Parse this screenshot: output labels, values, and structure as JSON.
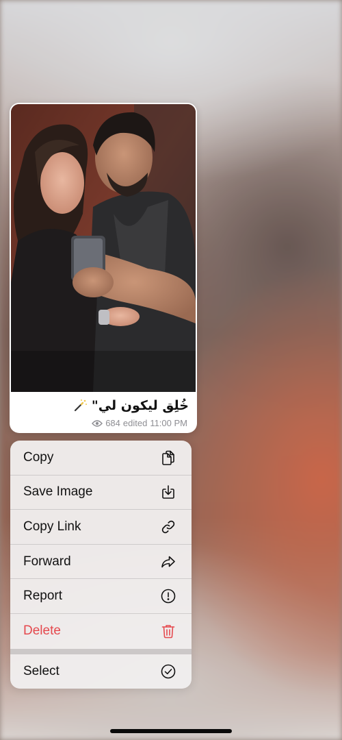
{
  "message": {
    "caption": "خُلِق ليكون لي\"",
    "views": "684",
    "edited_label": "edited",
    "time": "11:00 PM",
    "caption_icon": "magic-wand-icon"
  },
  "menu": {
    "items": [
      {
        "label": "Copy",
        "icon": "copy-icon"
      },
      {
        "label": "Save Image",
        "icon": "save-image-icon"
      },
      {
        "label": "Copy Link",
        "icon": "link-icon"
      },
      {
        "label": "Forward",
        "icon": "forward-icon"
      },
      {
        "label": "Report",
        "icon": "report-icon"
      },
      {
        "label": "Delete",
        "icon": "trash-icon"
      }
    ],
    "secondary": [
      {
        "label": "Select",
        "icon": "select-check-icon"
      }
    ]
  },
  "colors": {
    "danger": "#e5484d",
    "menu_background": "#f0eeee",
    "meta_text": "#8e8e93"
  }
}
